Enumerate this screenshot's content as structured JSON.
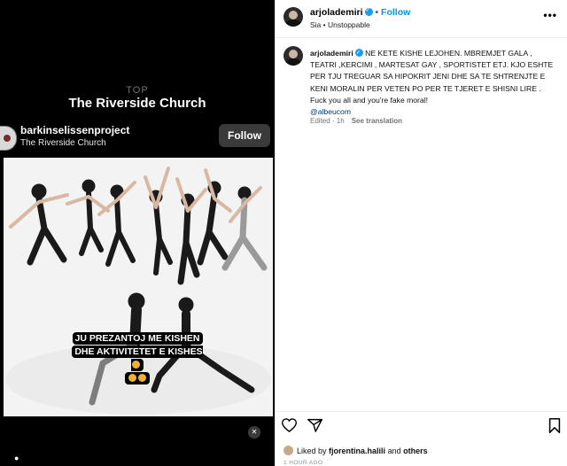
{
  "story": {
    "location_label": "TOP",
    "location_title": "The Riverside Church",
    "username": "barkinselissenproject",
    "location": "The Riverside Church",
    "follow_label": "Follow",
    "sticker_line1": "JU PREZANTOJ ME KISHEN",
    "sticker_line2": "DHE AKTIVITETET E KISHES"
  },
  "post": {
    "author": "arjolademiri",
    "separator": "•",
    "follow_label": "Follow",
    "audio": "Sia • Unstoppable",
    "more_icon": "more-horizontal-icon"
  },
  "comment": {
    "author": "arjolademiri",
    "text": "NE KETE KISHE LEJOHEN. MBREMJET GALA , TEATRI ,KERCIMI , MARTESAT GAY , SPORTISTET ETJ. KJO ESHTE PER TJU TREGUAR SA HIPOKRIT JENI DHE SA TE SHTRENJTE E KENI MORALIN PER VETEN PO PER TE TJERET E SHISNI LIRE . Fuck you all and you're fake moral!",
    "mention": "@albeucom",
    "meta": "Edited · 1h",
    "translate": "See translation"
  },
  "footer": {
    "liked_prefix": "Liked by",
    "liked_user": "fjorentina.halili",
    "liked_suffix": "and",
    "liked_others": "others",
    "time": "1 HOUR AGO"
  },
  "colors": {
    "accent_blue": "#0095f6",
    "verified_blue": "#1d9bf0",
    "media_bg": "#000000"
  }
}
